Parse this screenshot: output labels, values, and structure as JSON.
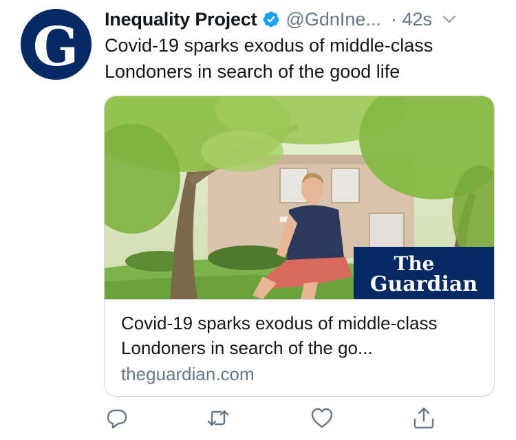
{
  "tweet": {
    "display_name": "Inequality Project",
    "handle": "@GdnIne...",
    "time": "· 42s",
    "text": "Covid-19 sparks exodus of middle-class Londoners in search of the good life",
    "avatar_letter": "G",
    "verified": true
  },
  "card": {
    "title": "Covid-19 sparks exodus of middle-class Londoners in search of the go...",
    "domain": "theguardian.com",
    "logo_line1": "The",
    "logo_line2": "Guardian"
  },
  "actions": [
    "reply-icon",
    "retweet-icon",
    "like-icon",
    "share-icon"
  ],
  "colors": {
    "brand_navy": "#052962",
    "verified_blue": "#1da1f2",
    "secondary_text": "#657786",
    "border": "#ccd6dd"
  }
}
